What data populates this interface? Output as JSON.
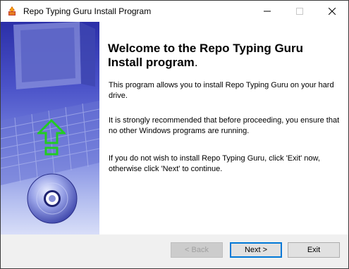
{
  "window": {
    "title": "Repo Typing Guru Install Program"
  },
  "content": {
    "welcome_heading": "Welcome to the Repo Typing Guru Install program",
    "welcome_period": ".",
    "paragraph_1": "This program allows you to install Repo Typing Guru on your hard drive.",
    "paragraph_2": "It is strongly recommended that before proceeding, you ensure that no other Windows programs are running.",
    "paragraph_3": "If you do not wish to install Repo Typing Guru, click 'Exit' now, otherwise click 'Next' to continue."
  },
  "buttons": {
    "back_label": "< Back",
    "next_label": "Next >",
    "exit_label": "Exit"
  },
  "icons": {
    "app": "installer-icon",
    "minimize": "minimize-icon",
    "maximize": "maximize-icon",
    "close": "close-icon",
    "arrow": "up-arrow-icon",
    "disc": "cd-disc-icon"
  },
  "colors": {
    "panel_top": "#2b2fa8",
    "arrow_green": "#22cc22",
    "default_button_border": "#0078d7"
  }
}
